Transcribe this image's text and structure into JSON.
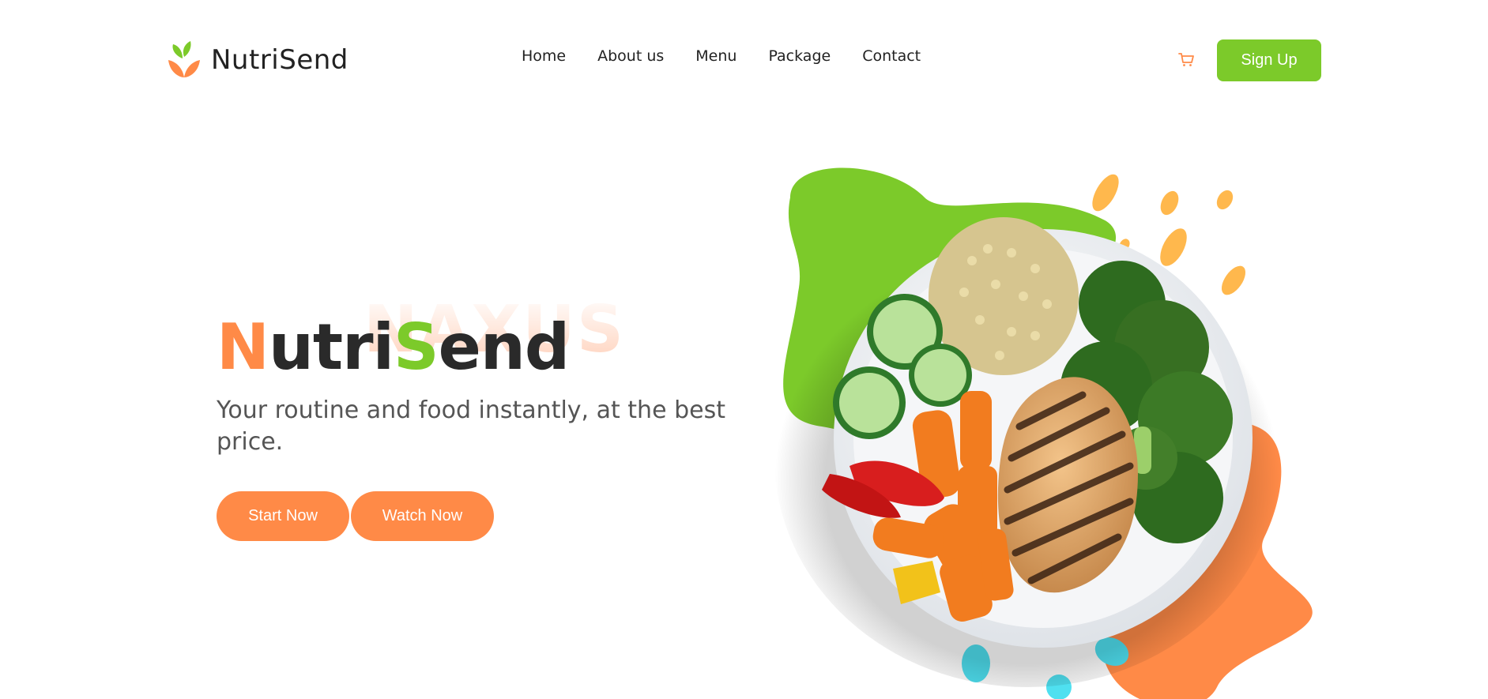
{
  "header": {
    "logo_text": "NutriSend",
    "logo_icon": "leaf-bowl-icon",
    "nav": [
      {
        "label": "Home"
      },
      {
        "label": "About us"
      },
      {
        "label": "Menu"
      },
      {
        "label": "Package"
      },
      {
        "label": "Contact"
      }
    ],
    "cart_icon": "cart-icon",
    "signup_label": "Sign Up"
  },
  "hero": {
    "watermark": "NAXUS",
    "title_parts": {
      "p1": "N",
      "p2": "utri",
      "p3": "S",
      "p4": "end"
    },
    "subtitle": "Your routine and food instantly, at the best price.",
    "start_label": "Start Now",
    "watch_label": "Watch Now"
  },
  "colors": {
    "accent_orange": "#ff8a47",
    "accent_green": "#7cca2a",
    "accent_cyan": "#4fe0f0",
    "text_dark": "#222222"
  }
}
